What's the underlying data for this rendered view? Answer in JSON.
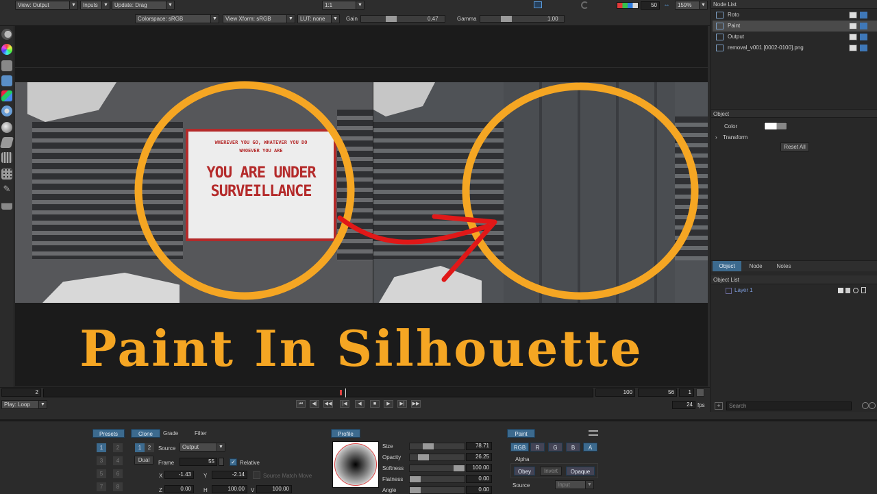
{
  "toolbar": {
    "view_output": "View: Output",
    "inputs": "Inputs",
    "update": "Update: Drag",
    "ratio": "1:1",
    "channel_value": "50",
    "zoom": "159%",
    "colorspace": "Colorspace: sRGB",
    "view_xform": "View Xform: sRGB",
    "lut": "LUT: none",
    "gain_label": "Gain",
    "gain_value": "0.47",
    "gamma_label": "Gamma",
    "gamma_value": "1.00"
  },
  "viewer": {
    "title": "Paint In Silhouette",
    "sign_line1": "WHEREVER YOU GO, WHATEVER YOU DO",
    "sign_line2": "WHOEVER YOU ARE",
    "sign_line3": "YOU ARE UNDER",
    "sign_line4": "SURVEILLANCE",
    "accent_color": "#f5a623",
    "arrow_color": "#e01818"
  },
  "timeline": {
    "start": "2",
    "end": "100",
    "current": "56",
    "step": "1",
    "play_mode": "Play: Loop",
    "fps_value": "24",
    "fps_unit": "fps"
  },
  "node_list": {
    "header": "Node List",
    "nodes": [
      {
        "name": "Roto"
      },
      {
        "name": "Paint"
      },
      {
        "name": "Output"
      },
      {
        "name": "removal_v001.[0002-0100].png"
      }
    ]
  },
  "object_panel": {
    "header": "Object",
    "color_label": "Color",
    "transform_label": "Transform",
    "reset_all": "Reset All",
    "tabs": [
      "Object",
      "Node",
      "Notes"
    ]
  },
  "object_list": {
    "header": "Object List",
    "layer": "Layer 1",
    "search_placeholder": "Search"
  },
  "bottom": {
    "presets": "Presets",
    "tabs": [
      "Clone",
      "Grade",
      "Filter"
    ],
    "keypad": [
      "1",
      "2",
      "3",
      "4",
      "5",
      "6",
      "7",
      "8"
    ],
    "clone_set": [
      "1",
      "2"
    ],
    "dual": "Dual",
    "source_label": "Source",
    "source_value": "Output",
    "frame_label": "Frame",
    "frame_value": "55",
    "relative": "Relative",
    "x_label": "X",
    "x_value": "-1.43",
    "y_label": "Y",
    "y_value": "-2.14",
    "source_match_move": "Source Match Move",
    "z_label": "Z",
    "z_value": "0.00",
    "h_label": "H",
    "h_value": "100.00",
    "v_label": "V",
    "v_value": "100.00",
    "profile": "Profile",
    "brush_params": [
      {
        "label": "Size",
        "value": "78.71"
      },
      {
        "label": "Opacity",
        "value": "26.25"
      },
      {
        "label": "Softness",
        "value": "100.00"
      },
      {
        "label": "Flatness",
        "value": "0.00"
      },
      {
        "label": "Angle",
        "value": "0.00"
      }
    ],
    "paint_tab": "Paint",
    "channels": [
      "RGB",
      "R",
      "G",
      "B",
      "A"
    ],
    "alpha_label": "Alpha",
    "alpha_modes": [
      "Obey",
      "Invert",
      "Opaque"
    ],
    "paint_source_label": "Source",
    "paint_source_value": "Input"
  }
}
